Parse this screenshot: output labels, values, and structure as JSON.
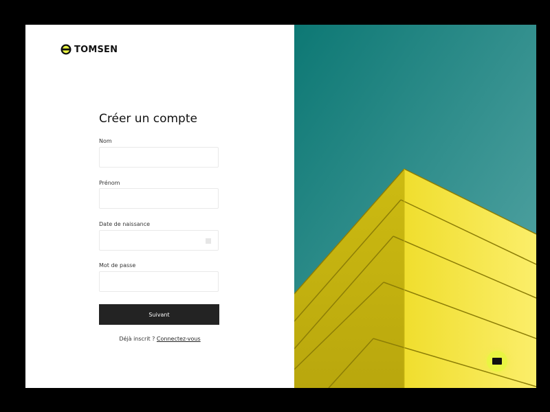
{
  "brand": {
    "name": "TOMSEN",
    "accent": "#e9f542"
  },
  "form": {
    "title": "Créer un compte",
    "fields": {
      "nom": {
        "label": "Nom",
        "value": "",
        "placeholder": ""
      },
      "prenom": {
        "label": "Prénom",
        "value": "",
        "placeholder": ""
      },
      "birthdate": {
        "label": "Date de naissance",
        "value": "",
        "placeholder": "",
        "icon": "calendar-icon"
      },
      "password": {
        "label": "Mot de passe",
        "value": "",
        "placeholder": ""
      }
    },
    "submit_label": "Suivant",
    "login_prompt": "Déjà inscrit ?",
    "login_link": "Connectez-vous"
  },
  "hero": {
    "sky_color": "#2f8f8a",
    "building_color": "#f1e03a"
  },
  "chat": {
    "icon": "chat-icon"
  }
}
